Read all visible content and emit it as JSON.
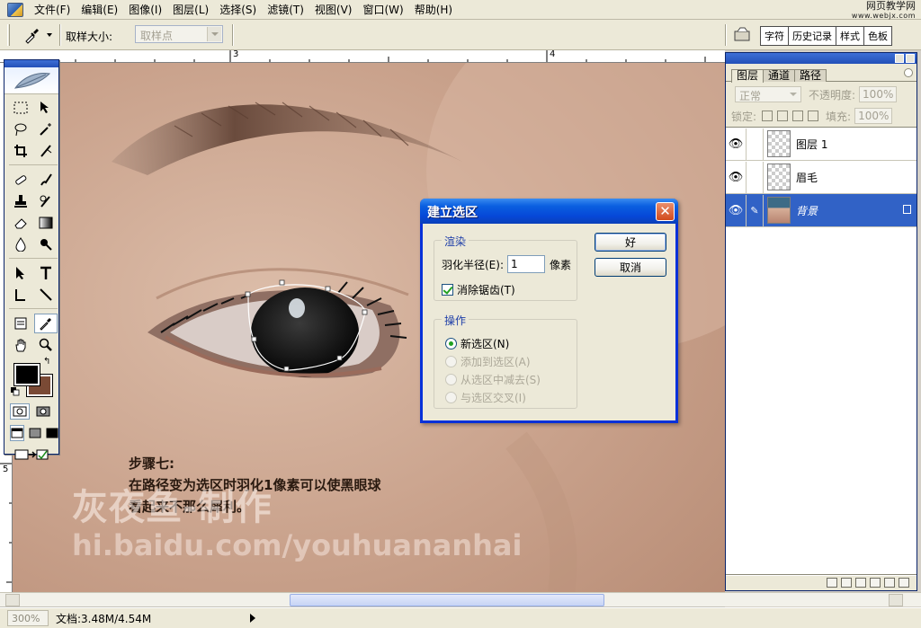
{
  "menubar": {
    "items": [
      "文件(F)",
      "编辑(E)",
      "图像(I)",
      "图层(L)",
      "选择(S)",
      "滤镜(T)",
      "视图(V)",
      "窗口(W)",
      "帮助(H)"
    ],
    "watermark_title": "网页教学网",
    "watermark_url": "www.webjx.com"
  },
  "options": {
    "sample_size_label": "取样大小:",
    "sample_size_value": "取样点",
    "well_tabs": [
      "字符",
      "历史记录",
      "样式",
      "色板"
    ]
  },
  "rulers": {
    "h_marks": [
      "3",
      "4"
    ],
    "v_marks": [
      "5"
    ]
  },
  "canvas": {
    "caption_line1": "步骤七:",
    "caption_line2": "在路径变为选区时羽化1像素可以使黑眼球",
    "caption_line3": "看起来不那么犀利。",
    "author": "灰夜鱼-制作",
    "author_url": "hi.baidu.com/youhuananhai"
  },
  "dialog": {
    "title": "建立选区",
    "close_glyph": "✕",
    "render_legend": "渲染",
    "feather_label": "羽化半径(E):",
    "feather_value": "1",
    "feather_unit": "像素",
    "antialias_label": "消除锯齿(T)",
    "antialias_checked": true,
    "operation_legend": "操作",
    "operations": [
      {
        "label": "新选区(N)",
        "checked": true,
        "enabled": true
      },
      {
        "label": "添加到选区(A)",
        "checked": false,
        "enabled": false
      },
      {
        "label": "从选区中减去(S)",
        "checked": false,
        "enabled": false
      },
      {
        "label": "与选区交叉(I)",
        "checked": false,
        "enabled": false
      }
    ],
    "ok_label": "好",
    "cancel_label": "取消"
  },
  "layers_panel": {
    "tabs": [
      "图层",
      "通道",
      "路径"
    ],
    "blend_mode": "正常",
    "opacity_label": "不透明度:",
    "opacity_value": "100%",
    "lock_label": "锁定:",
    "fill_label": "填充:",
    "fill_value": "100%",
    "layers": [
      {
        "name": "图层 1",
        "selected": false,
        "thumb": "transparent"
      },
      {
        "name": "眉毛",
        "selected": false,
        "thumb": "transparent"
      },
      {
        "name": "背景",
        "selected": true,
        "thumb": "photo"
      }
    ]
  },
  "status": {
    "zoom": "300%",
    "doc_info": "文档:3.48M/4.54M"
  },
  "colors": {
    "foreground": "#000000",
    "background": "#7a4a35",
    "selection_accent": "#3162c6"
  }
}
